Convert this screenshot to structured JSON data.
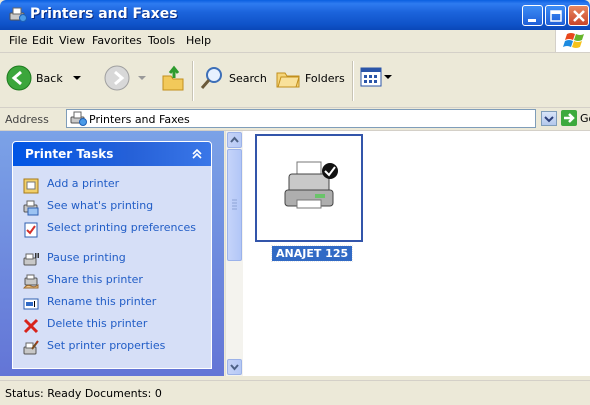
{
  "window": {
    "title": "Printers and Faxes"
  },
  "menu": [
    {
      "label": "File"
    },
    {
      "label": "Edit"
    },
    {
      "label": "View"
    },
    {
      "label": "Favorites"
    },
    {
      "label": "Tools"
    },
    {
      "label": "Help"
    }
  ],
  "toolbar": {
    "back_label": "Back",
    "search_label": "Search",
    "folders_label": "Folders"
  },
  "address": {
    "label": "Address",
    "value": "Printers and Faxes",
    "go_label": "Go"
  },
  "tasks": {
    "title": "Printer Tasks",
    "items": [
      {
        "label": "Add a printer",
        "icon": "add-printer-icon"
      },
      {
        "label": "See what's printing",
        "icon": "queue-icon"
      },
      {
        "label": "Select printing preferences",
        "icon": "preferences-icon"
      },
      {
        "label": "Pause printing",
        "icon": "pause-icon"
      },
      {
        "label": "Share this printer",
        "icon": "share-icon"
      },
      {
        "label": "Rename this printer",
        "icon": "rename-icon"
      },
      {
        "label": "Delete this printer",
        "icon": "delete-icon"
      },
      {
        "label": "Set printer properties",
        "icon": "properties-icon"
      }
    ]
  },
  "printers": [
    {
      "name": "ANAJET 125",
      "default": true,
      "selected": true
    }
  ],
  "status": {
    "text": "Status: Ready Documents: 0"
  },
  "colors": {
    "title_blue": "#0A5FE0",
    "task_link": "#215DC6",
    "selection": "#316AC5"
  }
}
